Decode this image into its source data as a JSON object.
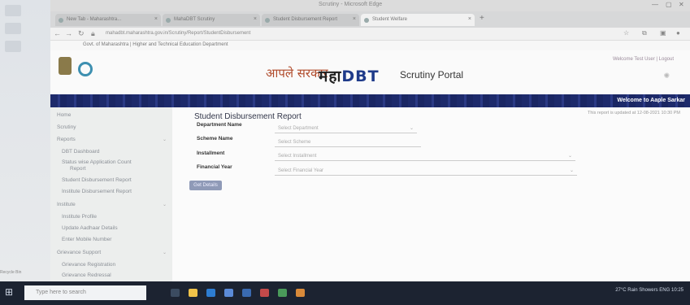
{
  "browser": {
    "window_title": "Scrutiny - Microsoft Edge",
    "tabs": [
      {
        "label": "New Tab - Maharashtra..."
      },
      {
        "label": "MahaDBT Scrutiny"
      },
      {
        "label": "Student Disbursement Report"
      },
      {
        "label": "Student Welfare"
      }
    ],
    "url": "mahadbt.maharashtra.gov.in/Scrutiny/Report/StudentDisbursement",
    "bookmark_text": "Govt. of Maharashtra | Higher and Technical Education Department"
  },
  "header": {
    "aaple_text": "आपले सरकार",
    "maha_text": "महा",
    "dbt_text": "DBT",
    "portal_title": "Scrutiny Portal",
    "user_info": "Welcome Test User | Logout",
    "welcome_banner": "Welcome to Aaple Sarkar"
  },
  "sidebar": {
    "items": [
      {
        "label": "Home",
        "sub": false
      },
      {
        "label": "Scrutiny",
        "sub": false
      },
      {
        "label": "Reports",
        "sub": false,
        "expand": "⌄"
      },
      {
        "label": "DBT Dashboard",
        "sub": true
      },
      {
        "label": "Status wise Application Count",
        "sub": true
      },
      {
        "label": "Report",
        "sub": true
      },
      {
        "label": "Student Disbursement Report",
        "sub": true
      },
      {
        "label": "Institute Disbursement Report",
        "sub": true
      },
      {
        "label": "Institute",
        "sub": false,
        "expand": "⌄"
      },
      {
        "label": "Institute Profile",
        "sub": true
      },
      {
        "label": "Update Aadhaar Details",
        "sub": true
      },
      {
        "label": "Enter Mobile Number",
        "sub": true
      },
      {
        "label": "Grievance Support",
        "sub": false,
        "expand": "⌄"
      },
      {
        "label": "Grievance Registration",
        "sub": true
      },
      {
        "label": "Grievance Redressal",
        "sub": true
      }
    ]
  },
  "main": {
    "report_title": "Student Disbursement Report",
    "last_updated": "This report is updated at 12-08-2021 10:30 PM",
    "fields": [
      {
        "label": "Department Name",
        "placeholder": "Select Department"
      },
      {
        "label": "Scheme Name",
        "placeholder": "Select Scheme"
      },
      {
        "label": "Installment",
        "placeholder": "Select Installment"
      },
      {
        "label": "Financial Year",
        "placeholder": "Select Financial Year"
      }
    ],
    "get_button": "Get Details"
  },
  "desktop": {
    "recycle_label": "Recycle Bin"
  },
  "taskbar": {
    "search_placeholder": "Type here to search",
    "tray_text": "27°C Rain Showers  ENG  10:25"
  },
  "colors": {
    "stripe": "#1d2a6b",
    "button": "#8f9ab7",
    "aaple_red": "#b04a2a",
    "dbt_blue": "#1f3b8a",
    "taskbar": "#1c2331"
  }
}
